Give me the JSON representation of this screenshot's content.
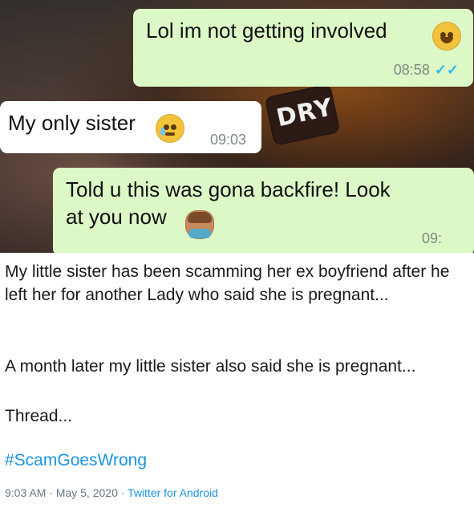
{
  "chat": {
    "messages": [
      {
        "type": "outgoing",
        "text": "Lol im not getting involved",
        "time": "08:58",
        "ticks": "✓✓",
        "emoji": "rolling-on-floor-laughing"
      },
      {
        "type": "incoming",
        "text": "My only sister",
        "time": "09:03",
        "emoji": "pleading-face"
      },
      {
        "type": "outgoing",
        "line1": "Told u this was gona backfire! Look",
        "line2": "at you now",
        "time": "09:",
        "emoji": "person-facepalming"
      }
    ],
    "background_text": "DRY"
  },
  "tweet": {
    "paragraph1": "My little sister has been scamming her ex boyfriend after he left her for another Lady who said she is pregnant...",
    "paragraph2": "A month later my little sister also said she is pregnant...",
    "paragraph3": "Thread...",
    "hashtag": "#ScamGoesWrong",
    "timestamp": "9:03 AM · May 5, 2020 · ",
    "client": "Twitter for Android"
  }
}
